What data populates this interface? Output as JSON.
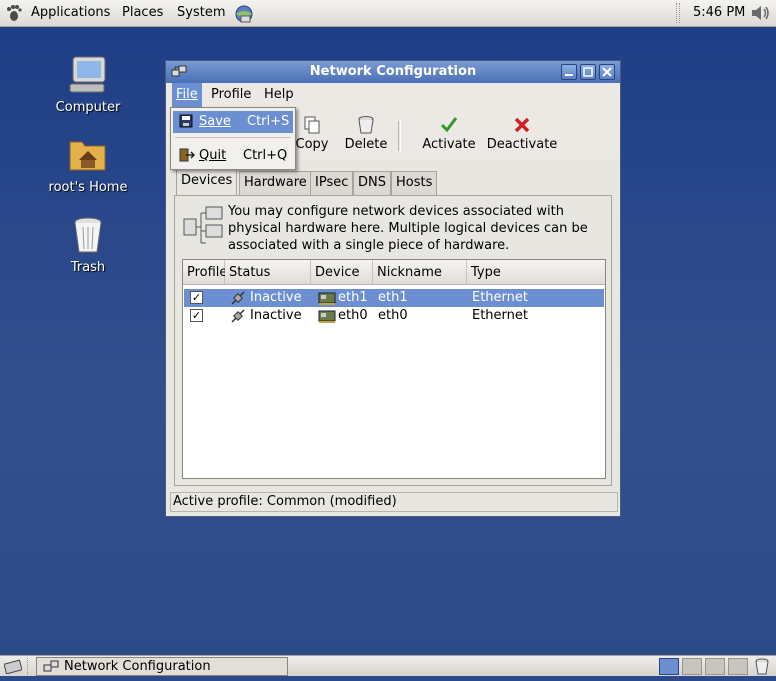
{
  "top_panel": {
    "menus": [
      "Applications",
      "Places",
      "System"
    ],
    "clock": "5:46 PM"
  },
  "desktop": {
    "icons": [
      {
        "label": "Computer"
      },
      {
        "label": "root's Home"
      },
      {
        "label": "Trash"
      }
    ]
  },
  "window": {
    "title": "Network Configuration",
    "menubar": [
      "File",
      "Profile",
      "Help"
    ],
    "toolbar": [
      "Copy",
      "Delete",
      "Activate",
      "Deactivate"
    ],
    "tabs": [
      "Devices",
      "Hardware",
      "IPsec",
      "DNS",
      "Hosts"
    ],
    "info_text": "You may configure network devices associated with physical hardware here.  Multiple logical devices can be associated with a single piece of hardware.",
    "table": {
      "columns": [
        "Profile",
        "Status",
        "Device",
        "Nickname",
        "Type"
      ],
      "rows": [
        {
          "profile": "✓",
          "status": "Inactive",
          "device": "eth1",
          "nickname": "eth1",
          "type": "Ethernet",
          "selected": true
        },
        {
          "profile": "✓",
          "status": "Inactive",
          "device": "eth0",
          "nickname": "eth0",
          "type": "Ethernet",
          "selected": false
        }
      ]
    },
    "status_bar": "Active profile: Common (modified)"
  },
  "file_menu": {
    "items": [
      {
        "label": "Save",
        "shortcut": "Ctrl+S"
      },
      {
        "label": "Quit",
        "shortcut": "Ctrl+Q"
      }
    ]
  },
  "taskbar": {
    "task": "Network Configuration"
  },
  "colors": {
    "desktop_bg": "#2c4a8a",
    "selection": "#6b8fd0",
    "titlebar": "#5a7fc2"
  }
}
